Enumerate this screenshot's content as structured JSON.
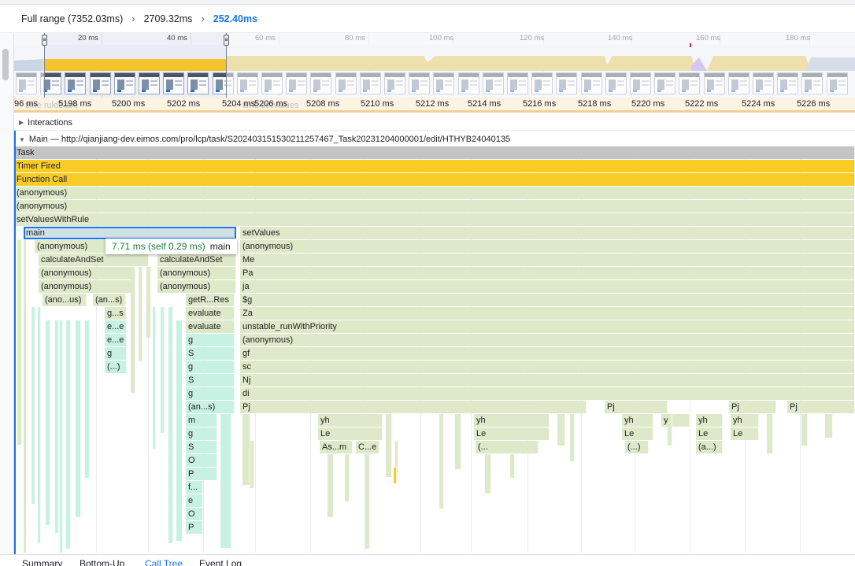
{
  "breadcrumb": {
    "full_range": "Full range (7352.03ms)",
    "mid_range": "2709.32ms",
    "current_range": "252.40ms",
    "separator_icon": "chevron-right-icon"
  },
  "overview": {
    "ticks": [
      "20 ms",
      "40 ms",
      "60 ms",
      "80 ms",
      "100 ms",
      "120 ms",
      "140 ms",
      "160 ms",
      "180 ms"
    ],
    "cpu_color": "#f0c43d",
    "handle_left_icon": "drag-handle-icon",
    "handle_right_icon": "drag-handle-icon"
  },
  "timeline_ruler": {
    "ticks": [
      "96 ms",
      "5198 ms",
      "5200 ms",
      "5202 ms",
      "5204 ms",
      "5206 ms",
      "5208 ms",
      "5210 ms",
      "5212 ms",
      "5214 ms",
      "5216 ms",
      "5218 ms",
      "5220 ms",
      "5222 ms",
      "5224 ms",
      "5226 ms"
    ],
    "ghost_left": "time ruleBase",
    "ghost_right": "time setValues"
  },
  "tracks": {
    "interactions_label": "Interactions",
    "main_label": "Main — http://qianjiang-dev.eimos.com/pro/lcp/task/S202403151530211257467_Task20231204000001/edit/HTHYB24040135"
  },
  "flame": {
    "task": "Task",
    "timer_fired": "Timer Fired",
    "function_call": "Function Call",
    "anon1": "(anonymous)",
    "anon2": "(anonymous)",
    "set_values_with_rule": "setValuesWithRule",
    "main": "main",
    "set_values": "setValues",
    "col_a": [
      "(anonymous)",
      "calculateAndSet",
      "(anonymous)",
      "(anonymous)",
      "(ano...us)"
    ],
    "col_a2": "(an...s)",
    "col_b": [
      "calculateAndSet",
      "(anonymous)",
      "(anonymous)"
    ],
    "col_c": [
      "getR...Res",
      "evaluate",
      "evaluate",
      "g",
      "S",
      "g",
      "S",
      "g",
      "(an...s)",
      "m",
      "g",
      "S",
      "O",
      "P",
      "f...",
      "e",
      "O",
      "P"
    ],
    "col_small": [
      "g...s",
      "e...e",
      "e...e",
      "g",
      "(...)"
    ],
    "col_d": [
      "(anonymous)",
      "Me",
      "Pa",
      "ja",
      "$g",
      "Za",
      "unstable_runWithPriority",
      "(anonymous)",
      "gf",
      "sc",
      "Nj",
      "di",
      "Pj"
    ],
    "pj": [
      "Pj",
      "Pj",
      "Pj"
    ],
    "yh": [
      "yh",
      "yh",
      "yh",
      "yh",
      "yh",
      "yh"
    ],
    "le": [
      "Le",
      "Le",
      "Le",
      "Le",
      "Le"
    ],
    "deep": [
      "As...m",
      "C...e",
      "(...",
      "(...)",
      "(a...)"
    ]
  },
  "tooltip": {
    "duration": "7.71 ms (self 0.29 ms)",
    "name": "main"
  },
  "bottom_tabs": [
    "Summary",
    "Bottom-Up",
    "Call Tree",
    "Event Log"
  ],
  "active_tab": "Call Tree"
}
